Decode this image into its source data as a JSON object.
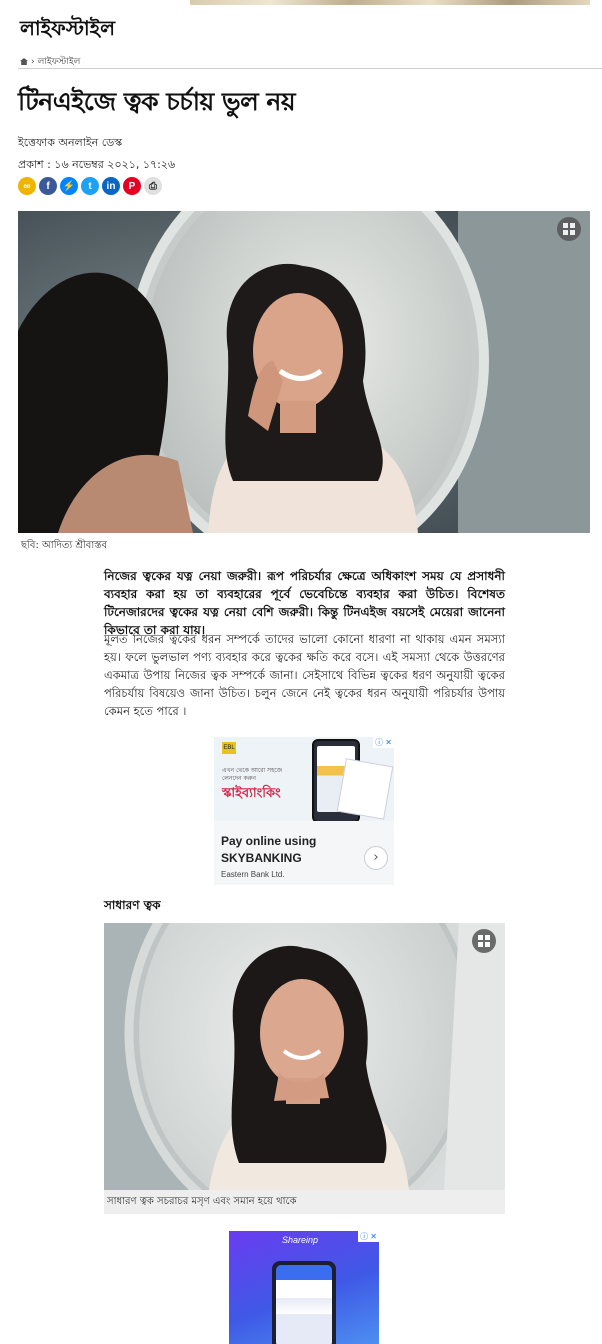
{
  "header": {
    "section_title": "লাইফস্টাইল"
  },
  "breadcrumb": {
    "home_icon": "home-icon",
    "separator": "›",
    "current": "লাইফস্টাইল"
  },
  "article": {
    "headline": "টিনএইজে ত্বক চর্চায় ভুল নয়",
    "byline": "ইত্তেফাক অনলাইন ডেস্ক",
    "published": "প্রকাশ : ১৬ নভেম্বর ২০২১, ১৭:২৬",
    "photo1_caption": "ছবি: আদিত্য শ্রীবাস্তব",
    "lead": "নিজের ত্বকের যত্ন নেয়া জরুরী। রূপ পরিচর্যার ক্ষেত্রে অধিকাংশ সময় যে প্রসাধনী ব্যবহার করা হয় তা ব্যবহারের পূর্বে ভেবেচিন্তে ব্যবহার করা উচিত। বিশেষত টিনেজারদের ত্বকের যত্ন নেয়া বেশি জরুরী। কিন্তু টিনএইজ বয়সেই মেয়েরা জানেনা কিভাবে তা করা যায়।",
    "paragraph1": "মূলত নিজের ত্বকের ধরন সম্পর্কে তাদের ভালো কোনো ধারণা না থাকায় এমন সমস্যা হয়। ফলে ভুলভাল পণ্য ব্যবহার করে ত্বকের ক্ষতি করে বসে। এই সমস্যা থেকে উত্তরণের একমাত্র উপায় নিজের ত্বক সম্পর্কে জানা। সেইসাথে বিভিন্ন ত্বকের ধরণ অনুযায়ী ত্বকের পরিচর্যায় বিষয়েও জানা উচিত। চলুন জেনে নেই ত্বকের ধরন অনুযায়ী পরিচর্যার উপায় কেমন হতে পারে ।",
    "subheading": "সাধারণ ত্বক",
    "photo2_caption": "সাধারণ ত্বক সচরাচর মসৃণ এবং সমান হয়ে থাকে"
  },
  "share_icons": [
    {
      "name": "link-icon",
      "color": "#f0b400",
      "glyph": "∞"
    },
    {
      "name": "facebook-icon",
      "color": "#3b5998",
      "glyph": "f"
    },
    {
      "name": "messenger-icon",
      "color": "#0084ff",
      "glyph": "⚡"
    },
    {
      "name": "twitter-icon",
      "color": "#1da1f2",
      "glyph": "t"
    },
    {
      "name": "linkedin-icon",
      "color": "#0a66c2",
      "glyph": "in"
    },
    {
      "name": "pinterest-icon",
      "color": "#e60023",
      "glyph": "P"
    },
    {
      "name": "print-icon",
      "color": "#e0e0e0",
      "glyph": "⎙"
    }
  ],
  "ad1": {
    "headline_bn": "স্কাইব্যাংকিং",
    "small_bn": "এখন থেকে আরো সহজে লেনদেন করুন",
    "cta_line1": "Pay online using",
    "cta_line2": "SKYBANKING",
    "sponsor": "Eastern Bank Ltd.",
    "badge": "EBL",
    "close_label": "ⓘ ✕"
  },
  "ad2": {
    "brand": "Shareinp",
    "close_label": "ⓘ ✕"
  }
}
